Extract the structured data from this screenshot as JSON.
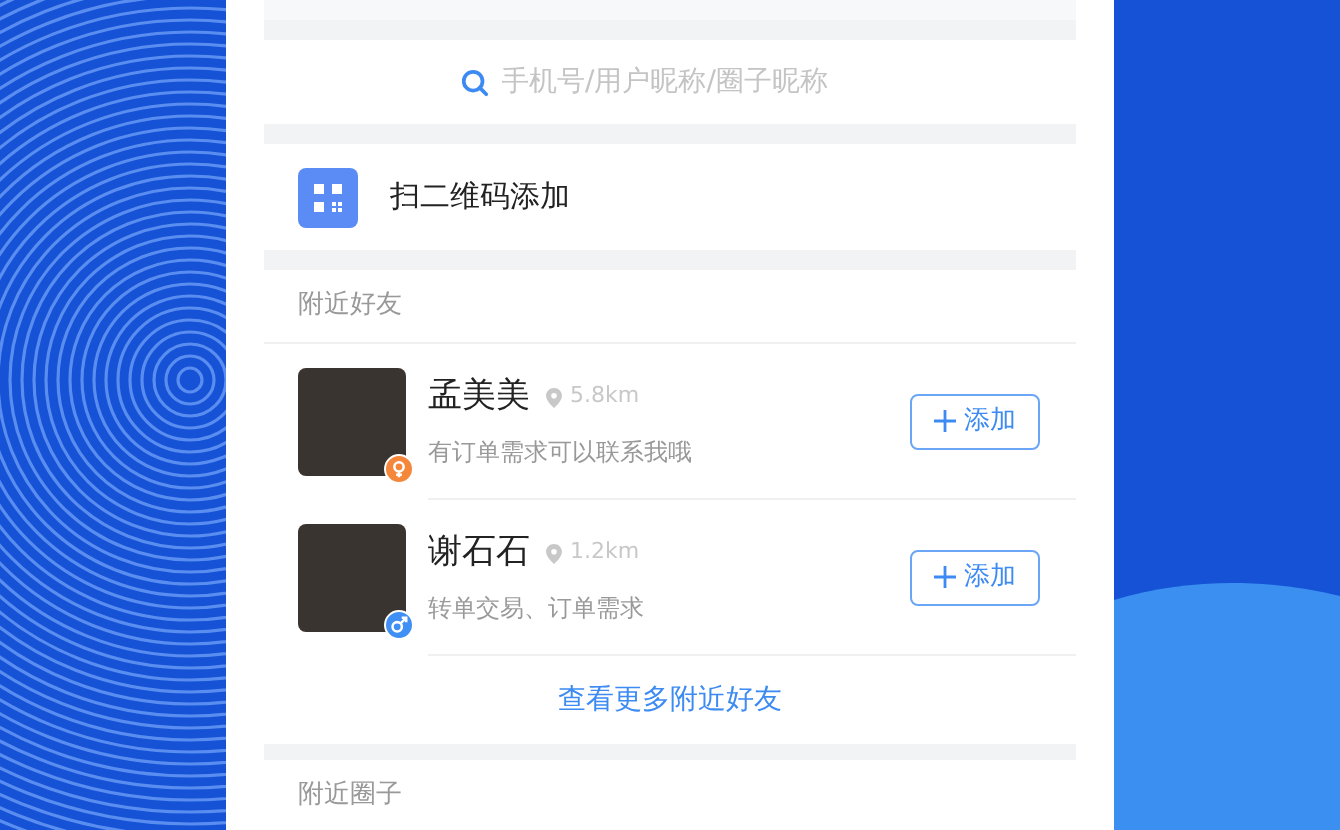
{
  "search": {
    "placeholder": "手机号/用户昵称/圈子昵称"
  },
  "scan_row": {
    "label": "扫二维码添加"
  },
  "nearby_friends": {
    "title": "附近好友",
    "people": [
      {
        "name": "孟美美",
        "distance": "5.8km",
        "bio": "有订单需求可以联系我哦",
        "kind": "female",
        "button": "添加"
      },
      {
        "name": "谢石石",
        "distance": "1.2km",
        "bio": "转单交易、订单需求",
        "kind": "male",
        "button": "添加"
      }
    ],
    "more_link": "查看更多附近好友"
  },
  "nearby_circles": {
    "title": "附近圈子"
  }
}
